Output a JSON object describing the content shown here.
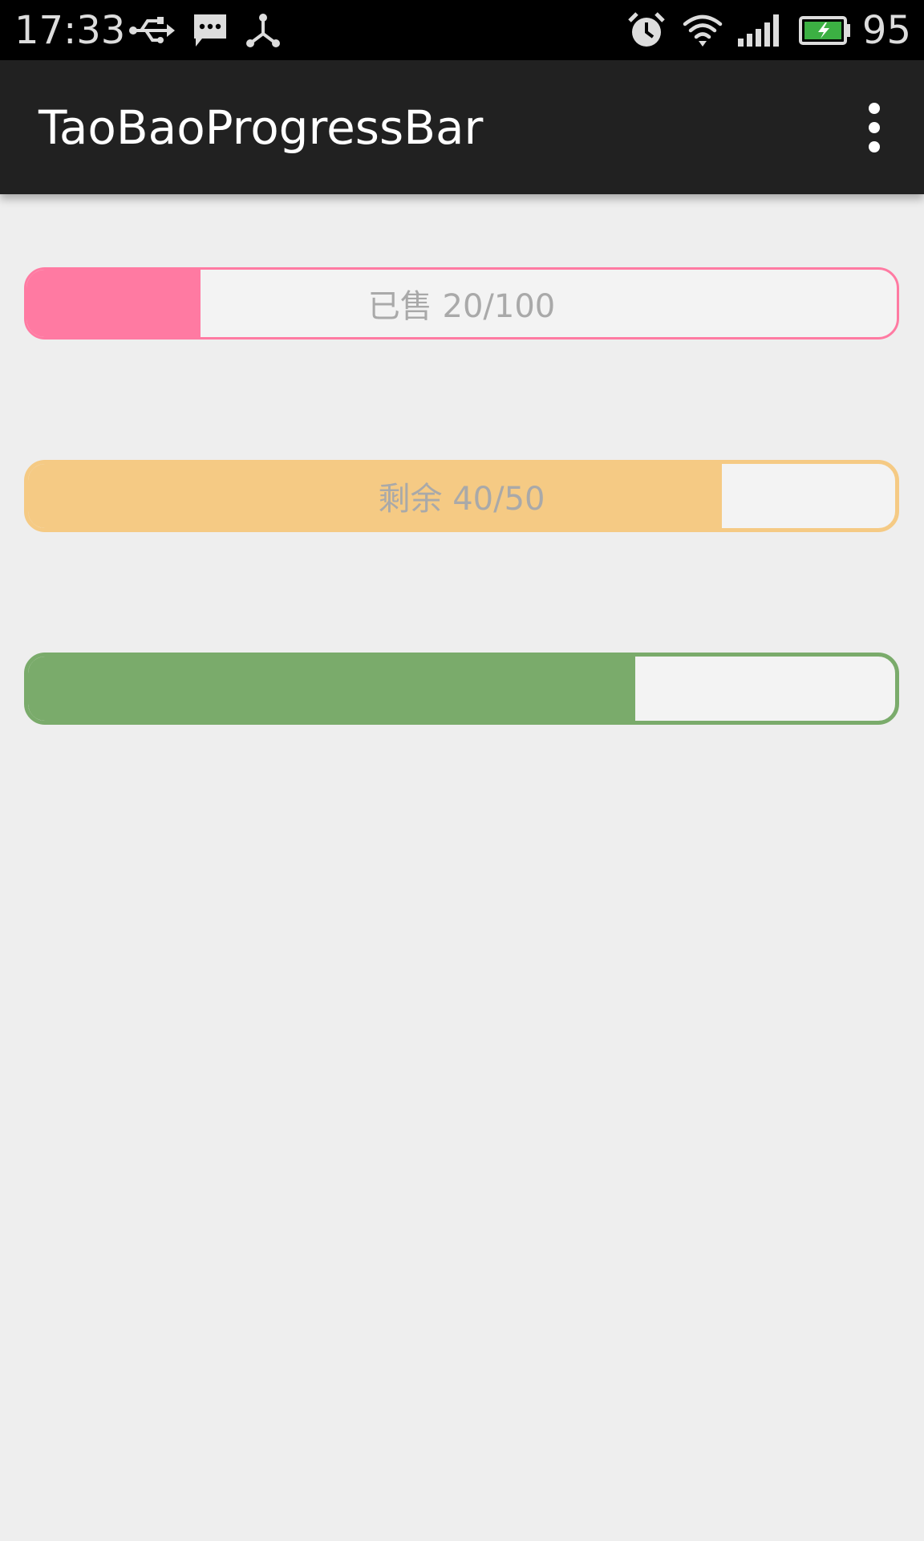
{
  "status_bar": {
    "time": "17:33",
    "battery_level": "95",
    "icons": [
      "usb-icon",
      "message-icon",
      "share-icon",
      "alarm-icon",
      "wifi-icon",
      "signal-icon",
      "battery-charging-icon"
    ]
  },
  "app_bar": {
    "title": "TaoBaoProgressBar",
    "menu_icon": "overflow-menu-icon"
  },
  "progress_bars": [
    {
      "label": "已售 20/100",
      "current": 20,
      "max": 100,
      "fraction": 0.2,
      "color": "#ff7aa2"
    },
    {
      "label": "剩余 40/50",
      "current": 40,
      "max": 50,
      "fraction": 0.8,
      "color": "#f5ca84"
    },
    {
      "label": "",
      "fraction": 0.7,
      "color": "#7aab6b"
    }
  ]
}
